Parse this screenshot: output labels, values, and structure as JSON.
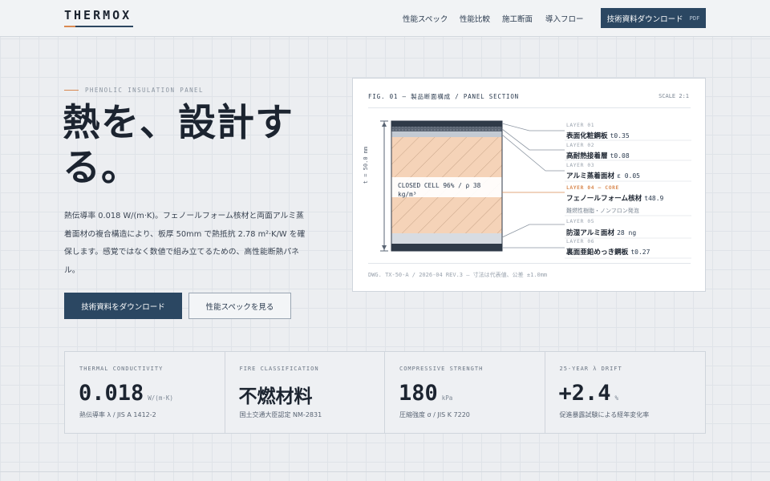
{
  "brand": {
    "logo": "THERMOX"
  },
  "nav": {
    "items": [
      "性能スペック",
      "性能比較",
      "施工断面",
      "導入フロー"
    ],
    "cta_label": "技術資料ダウンロード",
    "cta_badge": "PDF"
  },
  "hero": {
    "eyebrow": "PHENOLIC INSULATION PANEL",
    "title": "熱を、設計する。",
    "description": "熱伝導率 0.018 W/(m·K)。フェノールフォーム核材と両面アルミ蒸着面材の複合構造により、板厚 50mm で熱抵抗 2.78 m²·K/W を確保します。感覚ではなく数値で組み立てるための、高性能断熱パネル。",
    "primary_button": "技術資料をダウンロード",
    "secondary_button": "性能スペックを見る"
  },
  "figure": {
    "title": "FIG. 01 — 製品断面構成 / PANEL SECTION",
    "scale": "SCALE 2:1",
    "dimension": "t = 50.0 mm",
    "core_label": "CLOSED CELL 96% / ρ 38 kg/m³",
    "caption": "DWG. TX-50-A / 2026-04 REV.3 — 寸法は代表値、公差 ±1.0mm",
    "layers": [
      {
        "tag": "LAYER 01",
        "name": "表面化粧鋼板",
        "spec": "t0.35"
      },
      {
        "tag": "LAYER 02",
        "name": "高耐熱接着層",
        "spec": "t0.08"
      },
      {
        "tag": "LAYER 03",
        "name": "アルミ蒸着面材",
        "spec": "ε 0.05"
      },
      {
        "tag": "LAYER 04 — CORE",
        "name": "フェノールフォーム核材",
        "spec": "t48.9",
        "sub": "難燃性樹脂・ノンフロン発泡"
      },
      {
        "tag": "LAYER 05",
        "name": "防湿アルミ面材",
        "spec": "28 ng"
      },
      {
        "tag": "LAYER 06",
        "name": "裏面亜鉛めっき鋼板",
        "spec": "t0.27"
      }
    ]
  },
  "stats": [
    {
      "label": "THERMAL CONDUCTIVITY",
      "value": "0.018",
      "unit": "W/(m·K)",
      "note": "熱伝導率 λ / JIS A 1412-2"
    },
    {
      "label": "FIRE CLASSIFICATION",
      "value": "不燃材料",
      "unit": "",
      "note": "国土交通大臣認定 NM-2831"
    },
    {
      "label": "COMPRESSIVE STRENGTH",
      "value": "180",
      "unit": "kPa",
      "note": "圧縮強度 σ / JIS K 7220"
    },
    {
      "label": "25-YEAR λ DRIFT",
      "value": "+2.4",
      "unit": "%",
      "note": "促進暴露試験による経年変化率"
    }
  ],
  "colors": {
    "accent": "#d98a52",
    "primary": "#2b4762",
    "core_fill": "#f5d3b8"
  }
}
